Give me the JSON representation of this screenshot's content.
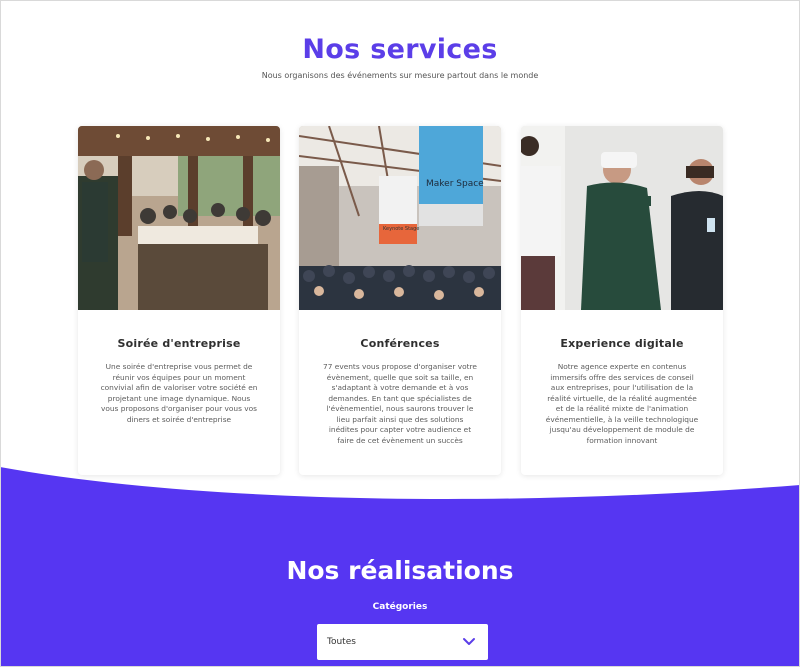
{
  "services": {
    "title": "Nos services",
    "subtitle": "Nous organisons des événements sur mesure partout dans le monde"
  },
  "cards": [
    {
      "title": "Soirée d'entreprise",
      "description": "Une soirée d'entreprise vous permet de réunir vos équipes pour un moment convivial afin de valoriser votre société en projetant une image dynamique. Nous vous proposons d'organiser pour vous vos diners et soirée d'entreprise",
      "image_alt": "business-dinner-photo"
    },
    {
      "title": "Conférences",
      "description": "77 events vous propose d'organiser votre évènement, quelle que soit sa taille, en s'adaptant à votre demande et à vos demandes. En tant que spécialistes de l'évènementiel, nous saurons trouver le lieu parfait ainsi que des solutions inédites pour capter votre audience et faire de cet évènement un succès",
      "image_alt": "conference-hall-photo",
      "sign_text": "Maker Space",
      "sign2_text": "Keynote Stage"
    },
    {
      "title": "Experience digitale",
      "description": "Notre agence experte en contenus immersifs offre des services de conseil aux entreprises, pour l'utilisation de la réalité virtuelle, de la réalité augmentée et de la réalité mixte de l'animation événementielle, à la veille technologique jusqu'au développement de module de formation innovant",
      "image_alt": "vr-headset-photo"
    }
  ],
  "realisations": {
    "title": "Nos réalisations",
    "category_label": "Catégories",
    "select_value": "Toutes"
  },
  "colors": {
    "accent": "#5b3ee8",
    "wave": "#5636f2"
  }
}
